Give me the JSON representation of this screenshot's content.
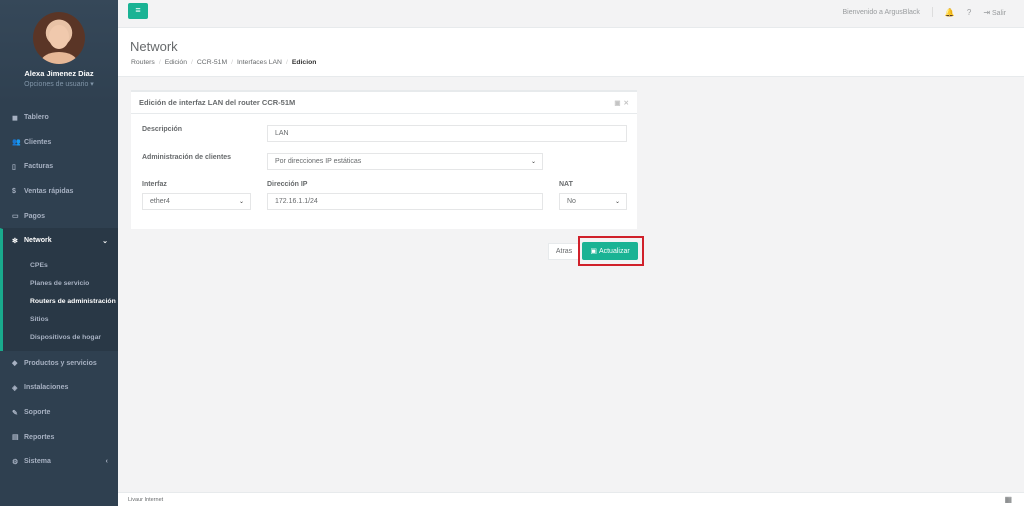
{
  "colors": {
    "sidebar": "#2f4050",
    "accent": "#1ab394",
    "highlight": "#d0202a"
  },
  "profile": {
    "name": "Alexa Jimenez Diaz",
    "options": "Opciones de usuario ▾"
  },
  "nav": {
    "tablero": "Tablero",
    "clientes": "Clientes",
    "facturas": "Facturas",
    "ventas": "Ventas rápidas",
    "pagos": "Pagos",
    "network": "Network",
    "sub": [
      "CPEs",
      "Planes de servicio",
      "Routers de administración",
      "Sitios",
      "Dispositivos de hogar"
    ],
    "productos": "Productos y servicios",
    "instalaciones": "Instalaciones",
    "soporte": "Soporte",
    "reportes": "Reportes",
    "sistema": "Sistema"
  },
  "topbar": {
    "welcome": "Bienvenido a ArgusBlack",
    "logout": "Salir"
  },
  "heading": {
    "title": "Network",
    "breadcrumb": [
      "Routers",
      "Edición",
      "CCR-51M",
      "Interfaces LAN",
      "Edicion"
    ]
  },
  "panel": {
    "title": "Edición de interfaz LAN del router CCR-51M",
    "descripcion_label": "Descripción",
    "descripcion_value": "LAN",
    "admin_label": "Administración de clientes",
    "admin_value": "Por direcciones IP estáticas",
    "interfaz_label": "Interfaz",
    "interfaz_value": "ether4",
    "ip_label": "Dirección IP",
    "ip_value": "172.16.1.1/24",
    "nat_label": "NAT",
    "nat_value": "No"
  },
  "actions": {
    "back": "Atras",
    "update": "Actualizar"
  },
  "footer": {
    "text": "Livaur Internet"
  }
}
